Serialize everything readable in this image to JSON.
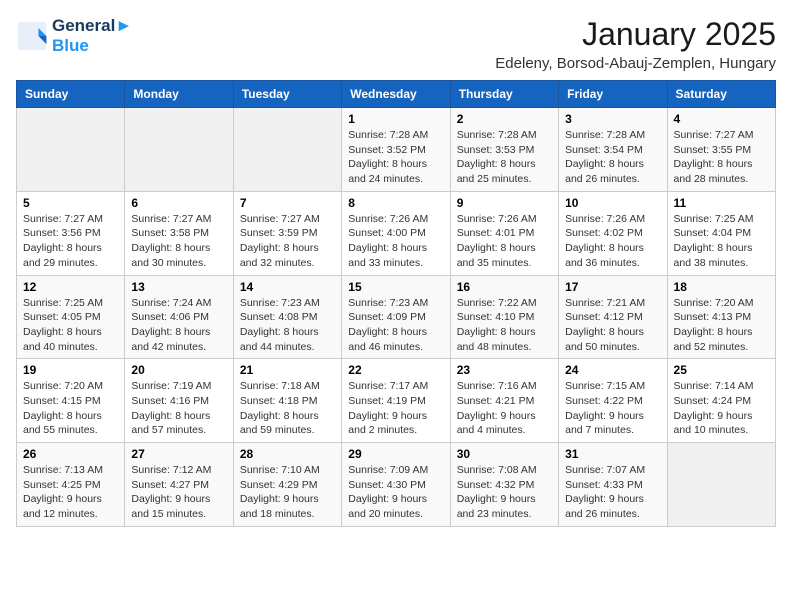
{
  "logo": {
    "line1": "General",
    "line2": "Blue"
  },
  "title": "January 2025",
  "subtitle": "Edeleny, Borsod-Abauj-Zemplen, Hungary",
  "days_of_week": [
    "Sunday",
    "Monday",
    "Tuesday",
    "Wednesday",
    "Thursday",
    "Friday",
    "Saturday"
  ],
  "weeks": [
    [
      {
        "day": "",
        "info": ""
      },
      {
        "day": "",
        "info": ""
      },
      {
        "day": "",
        "info": ""
      },
      {
        "day": "1",
        "info": "Sunrise: 7:28 AM\nSunset: 3:52 PM\nDaylight: 8 hours and 24 minutes."
      },
      {
        "day": "2",
        "info": "Sunrise: 7:28 AM\nSunset: 3:53 PM\nDaylight: 8 hours and 25 minutes."
      },
      {
        "day": "3",
        "info": "Sunrise: 7:28 AM\nSunset: 3:54 PM\nDaylight: 8 hours and 26 minutes."
      },
      {
        "day": "4",
        "info": "Sunrise: 7:27 AM\nSunset: 3:55 PM\nDaylight: 8 hours and 28 minutes."
      }
    ],
    [
      {
        "day": "5",
        "info": "Sunrise: 7:27 AM\nSunset: 3:56 PM\nDaylight: 8 hours and 29 minutes."
      },
      {
        "day": "6",
        "info": "Sunrise: 7:27 AM\nSunset: 3:58 PM\nDaylight: 8 hours and 30 minutes."
      },
      {
        "day": "7",
        "info": "Sunrise: 7:27 AM\nSunset: 3:59 PM\nDaylight: 8 hours and 32 minutes."
      },
      {
        "day": "8",
        "info": "Sunrise: 7:26 AM\nSunset: 4:00 PM\nDaylight: 8 hours and 33 minutes."
      },
      {
        "day": "9",
        "info": "Sunrise: 7:26 AM\nSunset: 4:01 PM\nDaylight: 8 hours and 35 minutes."
      },
      {
        "day": "10",
        "info": "Sunrise: 7:26 AM\nSunset: 4:02 PM\nDaylight: 8 hours and 36 minutes."
      },
      {
        "day": "11",
        "info": "Sunrise: 7:25 AM\nSunset: 4:04 PM\nDaylight: 8 hours and 38 minutes."
      }
    ],
    [
      {
        "day": "12",
        "info": "Sunrise: 7:25 AM\nSunset: 4:05 PM\nDaylight: 8 hours and 40 minutes."
      },
      {
        "day": "13",
        "info": "Sunrise: 7:24 AM\nSunset: 4:06 PM\nDaylight: 8 hours and 42 minutes."
      },
      {
        "day": "14",
        "info": "Sunrise: 7:23 AM\nSunset: 4:08 PM\nDaylight: 8 hours and 44 minutes."
      },
      {
        "day": "15",
        "info": "Sunrise: 7:23 AM\nSunset: 4:09 PM\nDaylight: 8 hours and 46 minutes."
      },
      {
        "day": "16",
        "info": "Sunrise: 7:22 AM\nSunset: 4:10 PM\nDaylight: 8 hours and 48 minutes."
      },
      {
        "day": "17",
        "info": "Sunrise: 7:21 AM\nSunset: 4:12 PM\nDaylight: 8 hours and 50 minutes."
      },
      {
        "day": "18",
        "info": "Sunrise: 7:20 AM\nSunset: 4:13 PM\nDaylight: 8 hours and 52 minutes."
      }
    ],
    [
      {
        "day": "19",
        "info": "Sunrise: 7:20 AM\nSunset: 4:15 PM\nDaylight: 8 hours and 55 minutes."
      },
      {
        "day": "20",
        "info": "Sunrise: 7:19 AM\nSunset: 4:16 PM\nDaylight: 8 hours and 57 minutes."
      },
      {
        "day": "21",
        "info": "Sunrise: 7:18 AM\nSunset: 4:18 PM\nDaylight: 8 hours and 59 minutes."
      },
      {
        "day": "22",
        "info": "Sunrise: 7:17 AM\nSunset: 4:19 PM\nDaylight: 9 hours and 2 minutes."
      },
      {
        "day": "23",
        "info": "Sunrise: 7:16 AM\nSunset: 4:21 PM\nDaylight: 9 hours and 4 minutes."
      },
      {
        "day": "24",
        "info": "Sunrise: 7:15 AM\nSunset: 4:22 PM\nDaylight: 9 hours and 7 minutes."
      },
      {
        "day": "25",
        "info": "Sunrise: 7:14 AM\nSunset: 4:24 PM\nDaylight: 9 hours and 10 minutes."
      }
    ],
    [
      {
        "day": "26",
        "info": "Sunrise: 7:13 AM\nSunset: 4:25 PM\nDaylight: 9 hours and 12 minutes."
      },
      {
        "day": "27",
        "info": "Sunrise: 7:12 AM\nSunset: 4:27 PM\nDaylight: 9 hours and 15 minutes."
      },
      {
        "day": "28",
        "info": "Sunrise: 7:10 AM\nSunset: 4:29 PM\nDaylight: 9 hours and 18 minutes."
      },
      {
        "day": "29",
        "info": "Sunrise: 7:09 AM\nSunset: 4:30 PM\nDaylight: 9 hours and 20 minutes."
      },
      {
        "day": "30",
        "info": "Sunrise: 7:08 AM\nSunset: 4:32 PM\nDaylight: 9 hours and 23 minutes."
      },
      {
        "day": "31",
        "info": "Sunrise: 7:07 AM\nSunset: 4:33 PM\nDaylight: 9 hours and 26 minutes."
      },
      {
        "day": "",
        "info": ""
      }
    ]
  ]
}
